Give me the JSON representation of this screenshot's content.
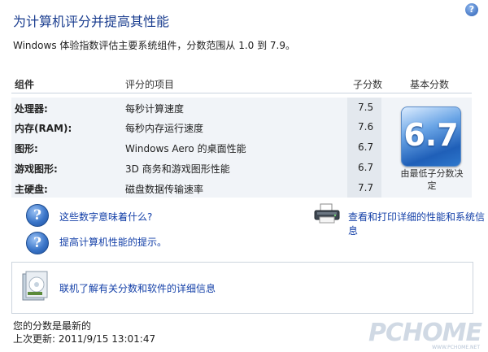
{
  "title": "为计算机评分并提高其性能",
  "help_icon": "?",
  "subtitle": "Windows 体验指数评估主要系统组件，分数范围从 1.0 到 7.9。",
  "table": {
    "headers": {
      "component": "组件",
      "item": "评分的项目",
      "subscore": "子分数",
      "base": "基本分数"
    },
    "rows": [
      {
        "component": "处理器:",
        "item": "每秒计算速度",
        "score": "7.5"
      },
      {
        "component": "内存(RAM):",
        "item": "每秒内存运行速度",
        "score": "7.6"
      },
      {
        "component": "图形:",
        "item": "Windows Aero 的桌面性能",
        "score": "6.7"
      },
      {
        "component": "游戏图形:",
        "item": "3D 商务和游戏图形性能",
        "score": "6.7"
      },
      {
        "component": "主硬盘:",
        "item": "磁盘数据传输速率",
        "score": "7.7"
      }
    ],
    "base_score": "6.7",
    "base_note": "由最低子分数决定"
  },
  "links": {
    "meaning": "这些数字意味着什么?",
    "tips": "提高计算机性能的提示。",
    "print": "查看和打印详细的性能和系统信息",
    "online": "联机了解有关分数和软件的详细信息"
  },
  "footer": {
    "status": "您的分数是最新的",
    "last_update": "上次更新: 2011/9/15 13:01:47"
  },
  "watermark": {
    "logo": "PCHOME",
    "url": "WWW.PCHOME.NET"
  },
  "colors": {
    "title": "#1a3d8f",
    "link": "#1440a8",
    "score_badge": "#1f5fb8"
  }
}
